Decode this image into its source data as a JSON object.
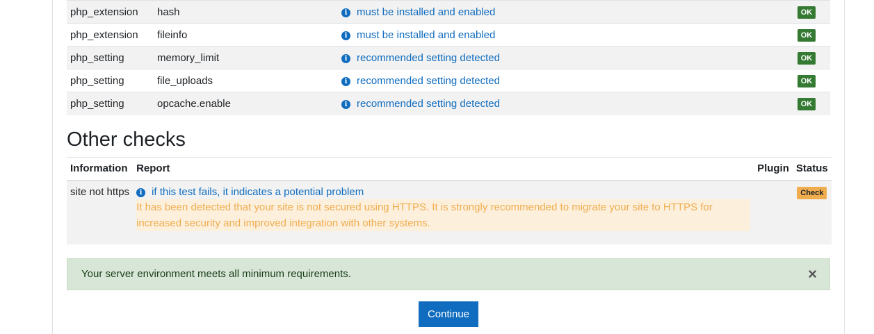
{
  "env_rows": [
    {
      "type": "php_extension",
      "name": "hash",
      "report": "must be installed and enabled",
      "status": "OK"
    },
    {
      "type": "php_extension",
      "name": "fileinfo",
      "report": "must be installed and enabled",
      "status": "OK"
    },
    {
      "type": "php_setting",
      "name": "memory_limit",
      "report": "recommended setting detected",
      "status": "OK"
    },
    {
      "type": "php_setting",
      "name": "file_uploads",
      "report": "recommended setting detected",
      "status": "OK"
    },
    {
      "type": "php_setting",
      "name": "opcache.enable",
      "report": "recommended setting detected",
      "status": "OK"
    }
  ],
  "other_checks": {
    "title": "Other checks",
    "headers": {
      "information": "Information",
      "report": "Report",
      "plugin": "Plugin",
      "status": "Status"
    },
    "rows": [
      {
        "information": "site not https",
        "report": "if this test fails, it indicates a potential problem",
        "warning": "It has been detected that your site is not secured using HTTPS. It is strongly recommended to migrate your site to HTTPS for increased security and improved integration with other systems.",
        "plugin": "",
        "status": "Check"
      }
    ]
  },
  "alert": {
    "message": "Your server environment meets all minimum requirements.",
    "close": "×"
  },
  "continue_label": "Continue",
  "icons": {
    "info": "i"
  },
  "colors": {
    "link": "#0f6cbf",
    "ok": "#357a32",
    "check": "#f0ad4e",
    "success_bg": "#d7e6d7"
  }
}
